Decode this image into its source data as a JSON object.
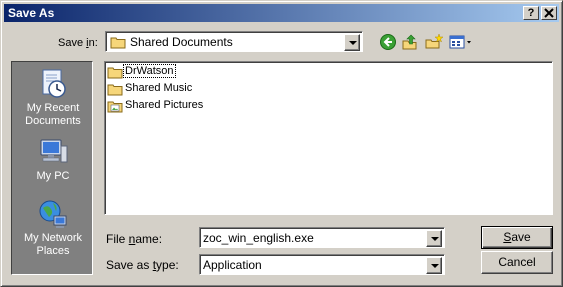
{
  "window": {
    "title": "Save As",
    "help_label": "?",
    "close_label": "X"
  },
  "toolbar": {
    "save_in_label_pre": "Save ",
    "save_in_label_key": "i",
    "save_in_label_post": "n:",
    "location_value": "Shared Documents",
    "tools": [
      "back-icon",
      "up-folder-icon",
      "new-folder-icon",
      "view-menu-icon"
    ]
  },
  "places": [
    {
      "label_line1": "My Recent",
      "label_line2": "Documents",
      "icon": "recent-documents-icon"
    },
    {
      "label_line1": "My PC",
      "label_line2": "",
      "icon": "my-pc-icon"
    },
    {
      "label_line1": "My Network",
      "label_line2": "Places",
      "icon": "network-places-icon"
    }
  ],
  "files": [
    {
      "name": "DrWatson",
      "icon": "folder-icon",
      "focused": true
    },
    {
      "name": "Shared Music",
      "icon": "folder-icon",
      "focused": false
    },
    {
      "name": "Shared Pictures",
      "icon": "folder-pictures-icon",
      "focused": false
    }
  ],
  "form": {
    "file_name_label_pre": "File ",
    "file_name_label_key": "n",
    "file_name_label_post": "ame:",
    "file_name_value": "zoc_win_english.exe",
    "type_label_pre": "Save as ",
    "type_label_key": "t",
    "type_label_post": "ype:",
    "type_value": "Application"
  },
  "buttons": {
    "save_key": "S",
    "save_rest": "ave",
    "cancel_label": "Cancel"
  }
}
